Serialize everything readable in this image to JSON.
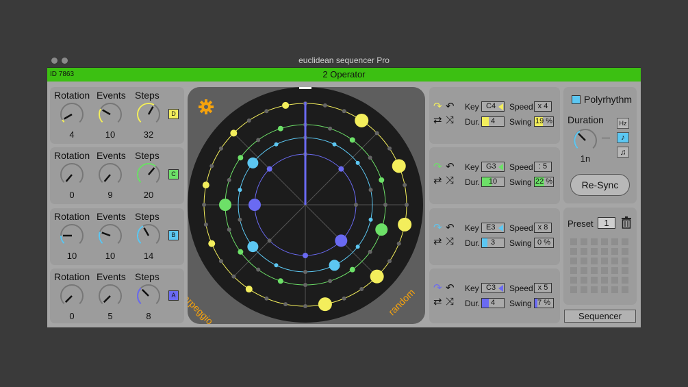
{
  "window": {
    "title": "euclidean sequencer Pro"
  },
  "header": {
    "id_label": "ID 7863",
    "title": "2 Operator"
  },
  "labels": {
    "rotation": "Rotation",
    "events": "Events",
    "steps": "Steps"
  },
  "tracks": [
    {
      "tag": "D",
      "color": "#f3ee5c",
      "rotation": "4",
      "events": "10",
      "steps": "32"
    },
    {
      "tag": "C",
      "color": "#6de068",
      "rotation": "0",
      "events": "9",
      "steps": "20"
    },
    {
      "tag": "B",
      "color": "#5cc7f2",
      "rotation": "10",
      "events": "10",
      "steps": "14"
    },
    {
      "tag": "A",
      "color": "#6a6af2",
      "rotation": "0",
      "events": "5",
      "steps": "8"
    }
  ],
  "circle": {
    "label_left": "arpeggio",
    "label_right": "random",
    "accent": "#f5a20d",
    "settings_icon": "gear-icon"
  },
  "right_labels": {
    "key": "Key",
    "speed": "Speed",
    "dur": "Dur.",
    "swing": "Swing"
  },
  "rows": [
    {
      "key": "C4",
      "speed": "x 4",
      "dur": "4",
      "swing": "19 %",
      "color": "#f3ee5c",
      "dur_fill": 0.3,
      "swing_fill": 0.45
    },
    {
      "key": "G3",
      "speed": ": 5",
      "dur": "10",
      "swing": "22 %",
      "color": "#6de068",
      "dur_fill": 0.45,
      "swing_fill": 0.5
    },
    {
      "key": "E3",
      "speed": "x 8",
      "dur": "3",
      "swing": "0 %",
      "color": "#5cc7f2",
      "dur_fill": 0.25,
      "swing_fill": 0.0
    },
    {
      "key": "C3",
      "speed": "x 5",
      "dur": "4",
      "swing": "7 %",
      "color": "#6a6af2",
      "dur_fill": 0.3,
      "swing_fill": 0.15
    }
  ],
  "sync": {
    "polyrhythm": "Polyrhythm",
    "duration": "Duration",
    "duration_value": "1n",
    "hz": "Hz",
    "note_icon": "♪",
    "notes_icon": "♫",
    "resync": "Re-Sync"
  },
  "preset": {
    "label": "Preset",
    "value": "1",
    "sequencer": "Sequencer"
  }
}
